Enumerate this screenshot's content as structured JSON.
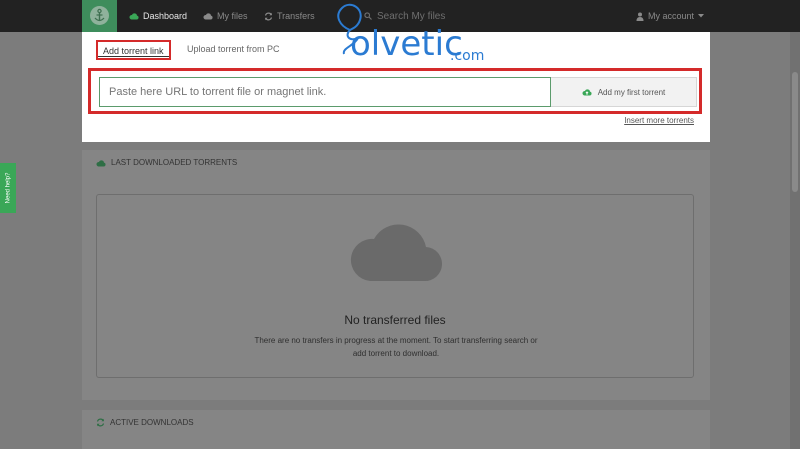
{
  "nav": {
    "items": [
      {
        "label": "Dashboard",
        "icon": "cloud-icon"
      },
      {
        "label": "My files",
        "icon": "cloud-icon"
      },
      {
        "label": "Transfers",
        "icon": "refresh-icon"
      }
    ],
    "search_placeholder": "Search My files",
    "account_label": "My account"
  },
  "add_torrent": {
    "tabs": [
      "Add torrent link",
      "Upload torrent from PC"
    ],
    "input_placeholder": "Paste here URL to torrent file or magnet link.",
    "button_label": "Add my first torrent",
    "more_link": "Insert more torrents"
  },
  "watermark": {
    "name": "olvetic",
    "domain": ".com"
  },
  "last_downloaded": {
    "title": "LAST DOWNLOADED TORRENTS",
    "empty_title": "No transferred files",
    "empty_desc": "There are no transfers in progress at the moment. To start transferring search or add torrent to download."
  },
  "active_downloads": {
    "title": "ACTIVE DOWNLOADS"
  },
  "help_tab": "Need help?",
  "colors": {
    "brand_green": "#3e8d5c",
    "accent_green": "#3aa757",
    "highlight_red": "#d42a2a",
    "watermark_blue": "#2b7bd2"
  }
}
